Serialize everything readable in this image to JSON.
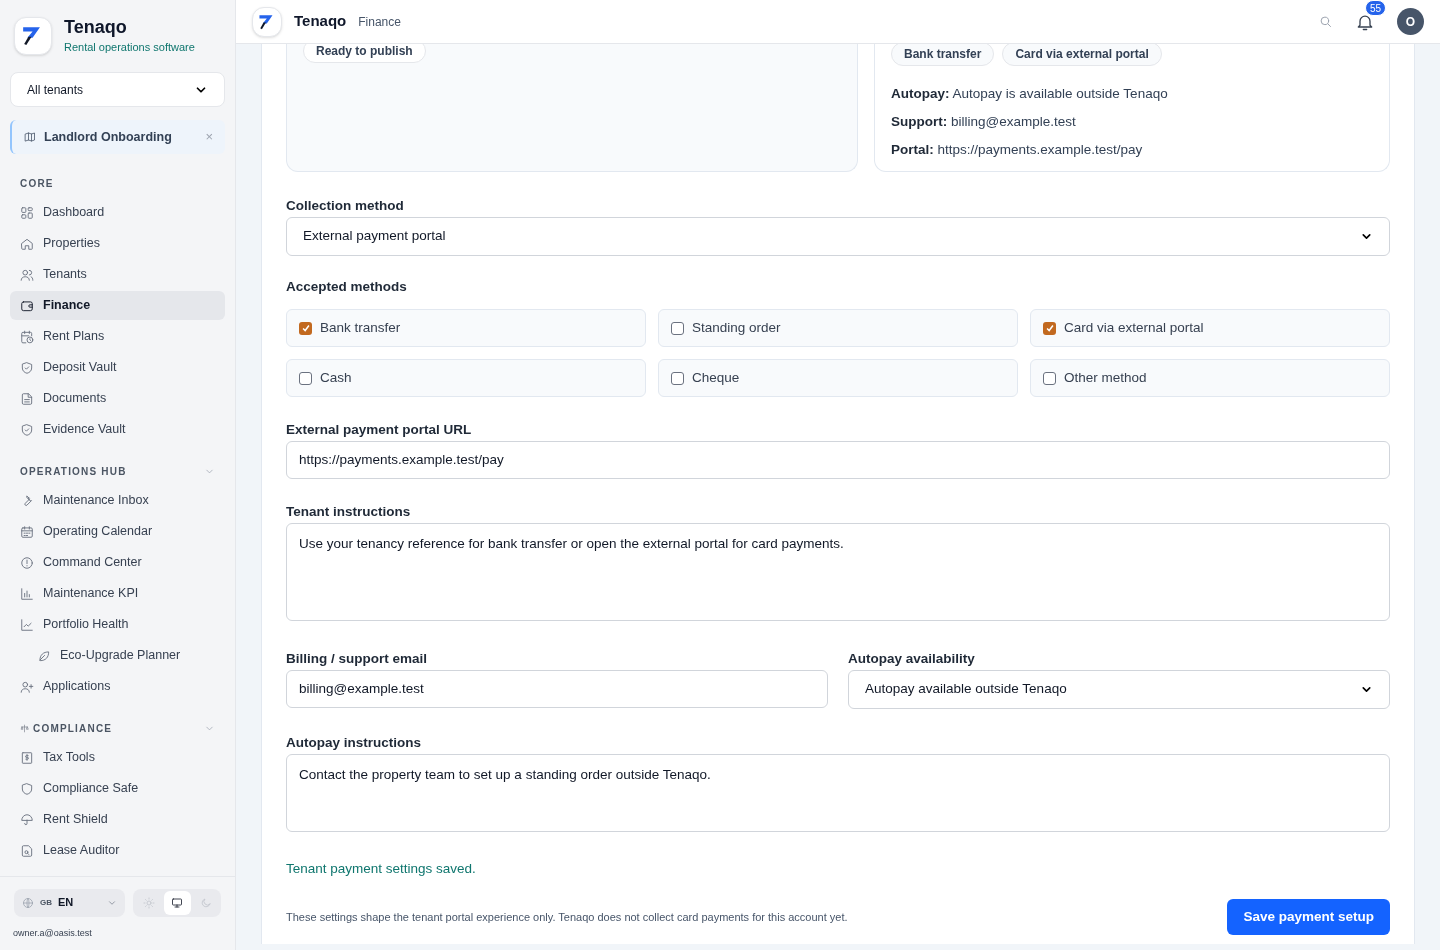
{
  "brand": {
    "name": "Tenaqo",
    "tagline": "Rental operations software"
  },
  "tenant_select": {
    "value": "All tenants"
  },
  "pinned": {
    "label": "Landlord Onboarding",
    "close": "×"
  },
  "sidebar": [
    {
      "heading": "CORE",
      "collapsible": false,
      "items": [
        {
          "label": "Dashboard",
          "selected": false
        },
        {
          "label": "Properties",
          "selected": false
        },
        {
          "label": "Tenants",
          "selected": false
        },
        {
          "label": "Finance",
          "selected": true
        },
        {
          "label": "Rent Plans",
          "selected": false
        },
        {
          "label": "Deposit Vault",
          "selected": false
        },
        {
          "label": "Documents",
          "selected": false
        },
        {
          "label": "Evidence Vault",
          "selected": false
        }
      ]
    },
    {
      "heading": "OPERATIONS HUB",
      "collapsible": true,
      "items": [
        {
          "label": "Maintenance Inbox",
          "selected": false
        },
        {
          "label": "Operating Calendar",
          "selected": false
        },
        {
          "label": "Command Center",
          "selected": false
        },
        {
          "label": "Maintenance KPI",
          "selected": false
        },
        {
          "label": "Portfolio Health",
          "selected": false,
          "children": [
            {
              "label": "Eco-Upgrade Planner",
              "selected": false
            }
          ]
        },
        {
          "label": "Applications",
          "selected": false
        }
      ]
    },
    {
      "heading": "COMPLIANCE",
      "collapsible": true,
      "items": [
        {
          "label": "Tax Tools",
          "selected": false
        },
        {
          "label": "Compliance Safe",
          "selected": false
        },
        {
          "label": "Rent Shield",
          "selected": false
        },
        {
          "label": "Lease Auditor",
          "selected": false
        }
      ]
    }
  ],
  "footer": {
    "language": "EN",
    "flag": "GB",
    "themes": [
      {
        "kind": "light",
        "selected": false
      },
      {
        "kind": "system",
        "selected": true
      },
      {
        "kind": "dark",
        "selected": false
      }
    ],
    "user_email": "owner.a@oasis.test"
  },
  "header": {
    "brand": "Tenaqo",
    "section": "Finance",
    "notifications": "55",
    "avatar": "O"
  },
  "preview": {
    "status": "Ready to publish",
    "methods": [
      "Bank transfer",
      "Card via external portal"
    ],
    "lines": [
      {
        "label": "Autopay:",
        "value": "Autopay is available outside Tenaqo"
      },
      {
        "label": "Support:",
        "value": "billing@example.test"
      },
      {
        "label": "Portal:",
        "value": "https://payments.example.test/pay"
      }
    ]
  },
  "collection_method": {
    "label": "Collection method",
    "value": "External payment portal"
  },
  "accepted_methods": {
    "label": "Accepted methods",
    "options": [
      {
        "label": "Bank transfer",
        "checked": true
      },
      {
        "label": "Standing order",
        "checked": false
      },
      {
        "label": "Card via external portal",
        "checked": true
      },
      {
        "label": "Cash",
        "checked": false
      },
      {
        "label": "Cheque",
        "checked": false
      },
      {
        "label": "Other method",
        "checked": false
      }
    ]
  },
  "portal_url": {
    "label": "External payment portal URL",
    "value": "https://payments.example.test/pay"
  },
  "tenant_instructions": {
    "label": "Tenant instructions",
    "value": "Use your tenancy reference for bank transfer or open the external portal for card payments."
  },
  "support_email": {
    "label": "Billing / support email",
    "value": "billing@example.test"
  },
  "autopay": {
    "label": "Autopay availability",
    "value": "Autopay available outside Tenaqo"
  },
  "autopay_instructions": {
    "label": "Autopay instructions",
    "value": "Contact the property team to set up a standing order outside Tenaqo."
  },
  "status_message": "Tenant payment settings saved.",
  "disclaimer": "These settings shape the tenant portal experience only. Tenaqo does not collect card payments for this account yet.",
  "save_button": "Save payment setup"
}
